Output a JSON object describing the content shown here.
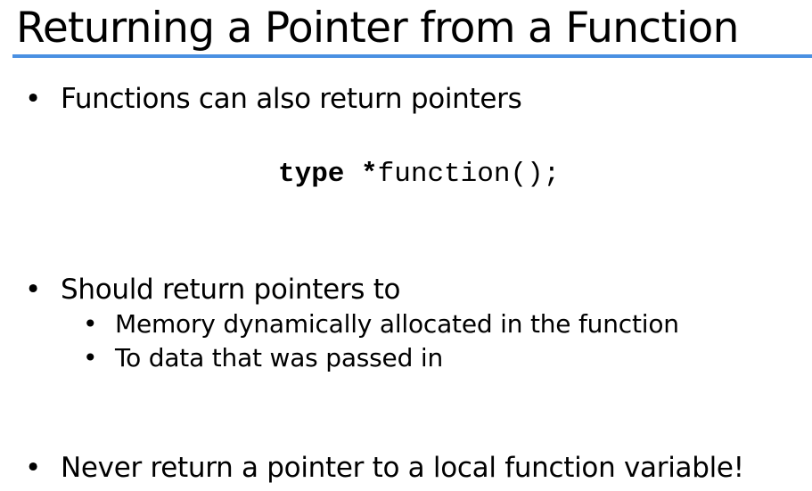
{
  "slide": {
    "title": "Returning a Pointer from a Function",
    "bullets": [
      {
        "marker": "•",
        "text": "Functions can also return pointers"
      },
      {
        "marker": "•",
        "text": "Should return pointers to"
      },
      {
        "marker": "•",
        "text": "Never return a pointer to a local function variable!"
      }
    ],
    "sub_bullets": [
      {
        "marker": "•",
        "text": "Memory dynamically allocated in the function"
      },
      {
        "marker": "•",
        "text": "To data that was passed in"
      }
    ],
    "code": {
      "keyword": "type",
      "star": " *",
      "rest": "function();"
    }
  },
  "colors": {
    "title_rule": "#4a90e2"
  }
}
